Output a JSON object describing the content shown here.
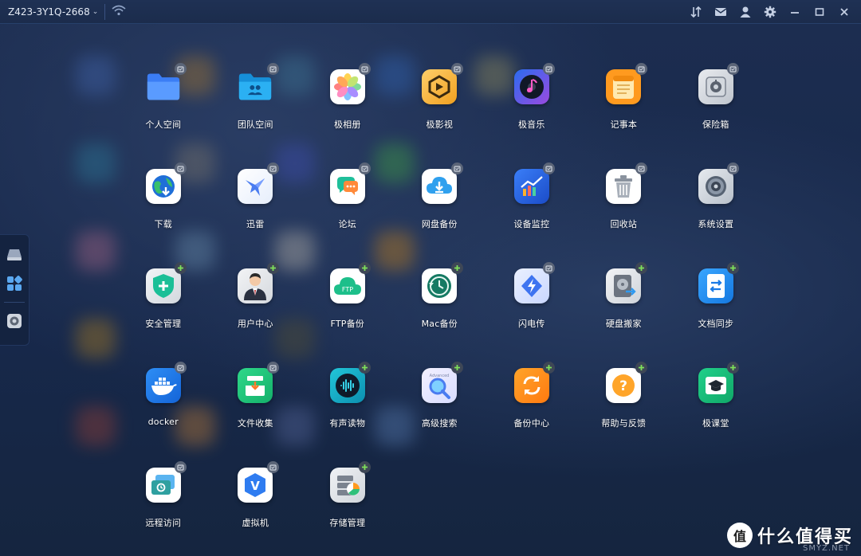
{
  "titlebar": {
    "device_name": "Z423-3Y1Q-2668",
    "icons": [
      "sort-icon",
      "mail-icon",
      "user-icon",
      "settings-icon",
      "minimize-icon",
      "maximize-icon",
      "close-icon"
    ]
  },
  "dock": {
    "items": [
      "drive-icon",
      "apps-grid-icon",
      "safe-icon"
    ]
  },
  "apps": [
    {
      "label": "个人空间",
      "icon": "personal-folder-icon",
      "badge": "installed"
    },
    {
      "label": "团队空间",
      "icon": "team-folder-icon",
      "badge": "installed"
    },
    {
      "label": "极相册",
      "icon": "photos-icon",
      "badge": "installed"
    },
    {
      "label": "极影视",
      "icon": "video-icon",
      "badge": "installed"
    },
    {
      "label": "极音乐",
      "icon": "music-icon",
      "badge": "installed"
    },
    {
      "label": "记事本",
      "icon": "notepad-icon",
      "badge": "installed"
    },
    {
      "label": "保险箱",
      "icon": "safe-icon",
      "badge": "installed"
    },
    {
      "label": "下载",
      "icon": "download-globe-icon",
      "badge": "installed"
    },
    {
      "label": "迅雷",
      "icon": "xunlei-bird-icon",
      "badge": "installed"
    },
    {
      "label": "论坛",
      "icon": "forum-chat-icon",
      "badge": "installed"
    },
    {
      "label": "网盘备份",
      "icon": "cloud-backup-icon",
      "badge": "installed"
    },
    {
      "label": "设备监控",
      "icon": "monitor-chart-icon",
      "badge": "installed"
    },
    {
      "label": "回收站",
      "icon": "trash-icon",
      "badge": "installed"
    },
    {
      "label": "系统设置",
      "icon": "system-settings-icon",
      "badge": "installed"
    },
    {
      "label": "安全管理",
      "icon": "shield-plus-icon",
      "badge": "add"
    },
    {
      "label": "用户中心",
      "icon": "user-center-icon",
      "badge": "add"
    },
    {
      "label": "FTP备份",
      "icon": "ftp-cloud-icon",
      "badge": "add"
    },
    {
      "label": "Mac备份",
      "icon": "time-machine-icon",
      "badge": "add"
    },
    {
      "label": "闪电传",
      "icon": "flash-transfer-icon",
      "badge": "installed"
    },
    {
      "label": "硬盘搬家",
      "icon": "disk-move-icon",
      "badge": "add"
    },
    {
      "label": "文档同步",
      "icon": "doc-sync-icon",
      "badge": "add"
    },
    {
      "label": "docker",
      "icon": "docker-whale-icon",
      "badge": "installed"
    },
    {
      "label": "文件收集",
      "icon": "file-collect-icon",
      "badge": "installed"
    },
    {
      "label": "有声读物",
      "icon": "audiobook-icon",
      "badge": "add"
    },
    {
      "label": "高级搜索",
      "icon": "advanced-search-icon",
      "badge": "add"
    },
    {
      "label": "备份中心",
      "icon": "backup-center-icon",
      "badge": "add"
    },
    {
      "label": "帮助与反馈",
      "icon": "help-icon",
      "badge": "add"
    },
    {
      "label": "极课堂",
      "icon": "classroom-icon",
      "badge": "add"
    },
    {
      "label": "远程访问",
      "icon": "remote-access-icon",
      "badge": "installed"
    },
    {
      "label": "虚拟机",
      "icon": "virtual-machine-icon",
      "badge": "installed"
    },
    {
      "label": "存储管理",
      "icon": "storage-manage-icon",
      "badge": "add"
    }
  ],
  "icon_text": {
    "ftp": "FTP",
    "search_tag": "Advanced",
    "help": "?",
    "vm": "V"
  },
  "watermark": {
    "logo_char": "值",
    "text": "什么值得买",
    "sub": "SMYZ.NET"
  }
}
